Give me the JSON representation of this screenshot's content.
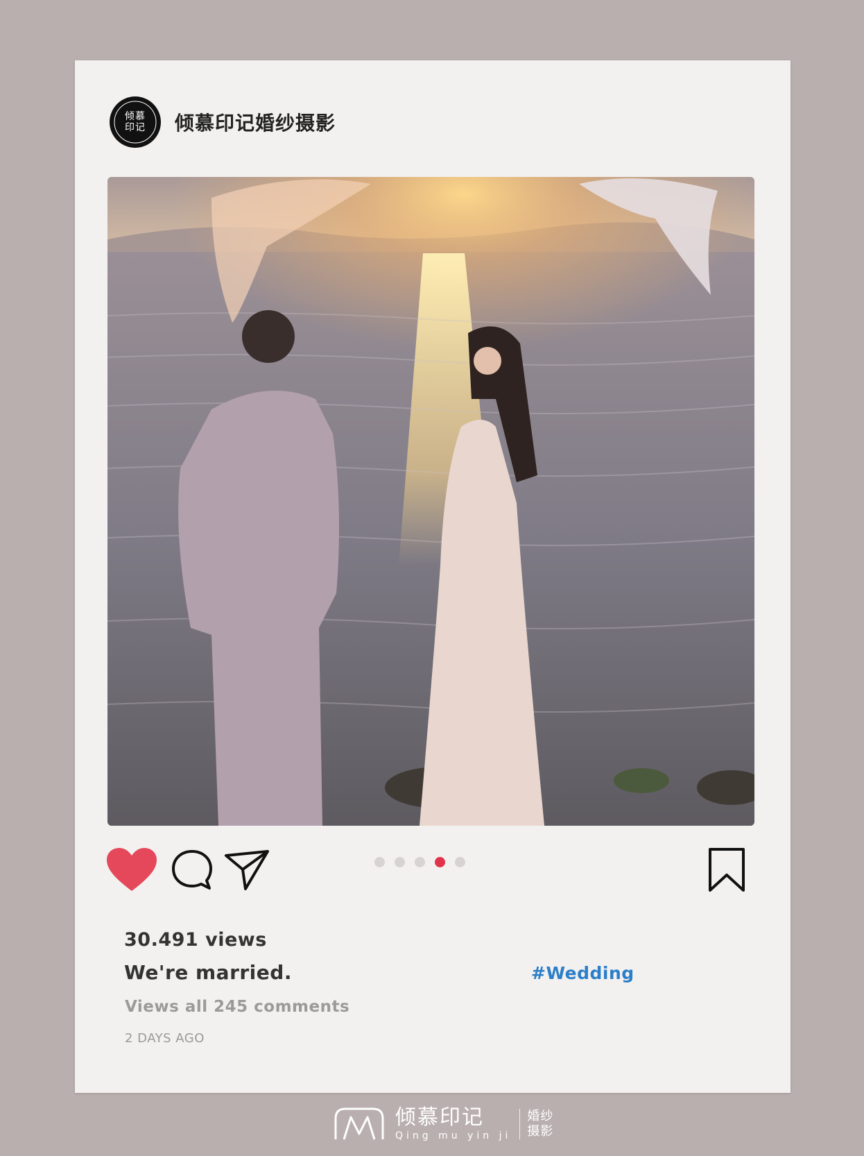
{
  "post": {
    "account_name": "倾慕印记婚纱摄影",
    "avatar_logo_text": "倾慕印记",
    "carousel": {
      "total": 5,
      "active_index": 3
    },
    "liked": true,
    "views_text": "30.491 views",
    "caption": "We're married.",
    "hashtag": "#Wedding",
    "comments_link": "Views all 245 comments",
    "timestamp": "2 DAYS AGO"
  },
  "footer": {
    "brand_cn": "倾慕印记",
    "brand_pinyin": "Qing mu yin ji",
    "brand_sub": "婚纱摄影"
  },
  "colors": {
    "background": "#b9afae",
    "card": "#f3f1ef",
    "heart": "#e5485b",
    "active_dot": "#e1344a",
    "hashtag": "#2b7ec9"
  },
  "icons": [
    "heart-icon",
    "comment-icon",
    "share-icon",
    "bookmark-icon"
  ]
}
